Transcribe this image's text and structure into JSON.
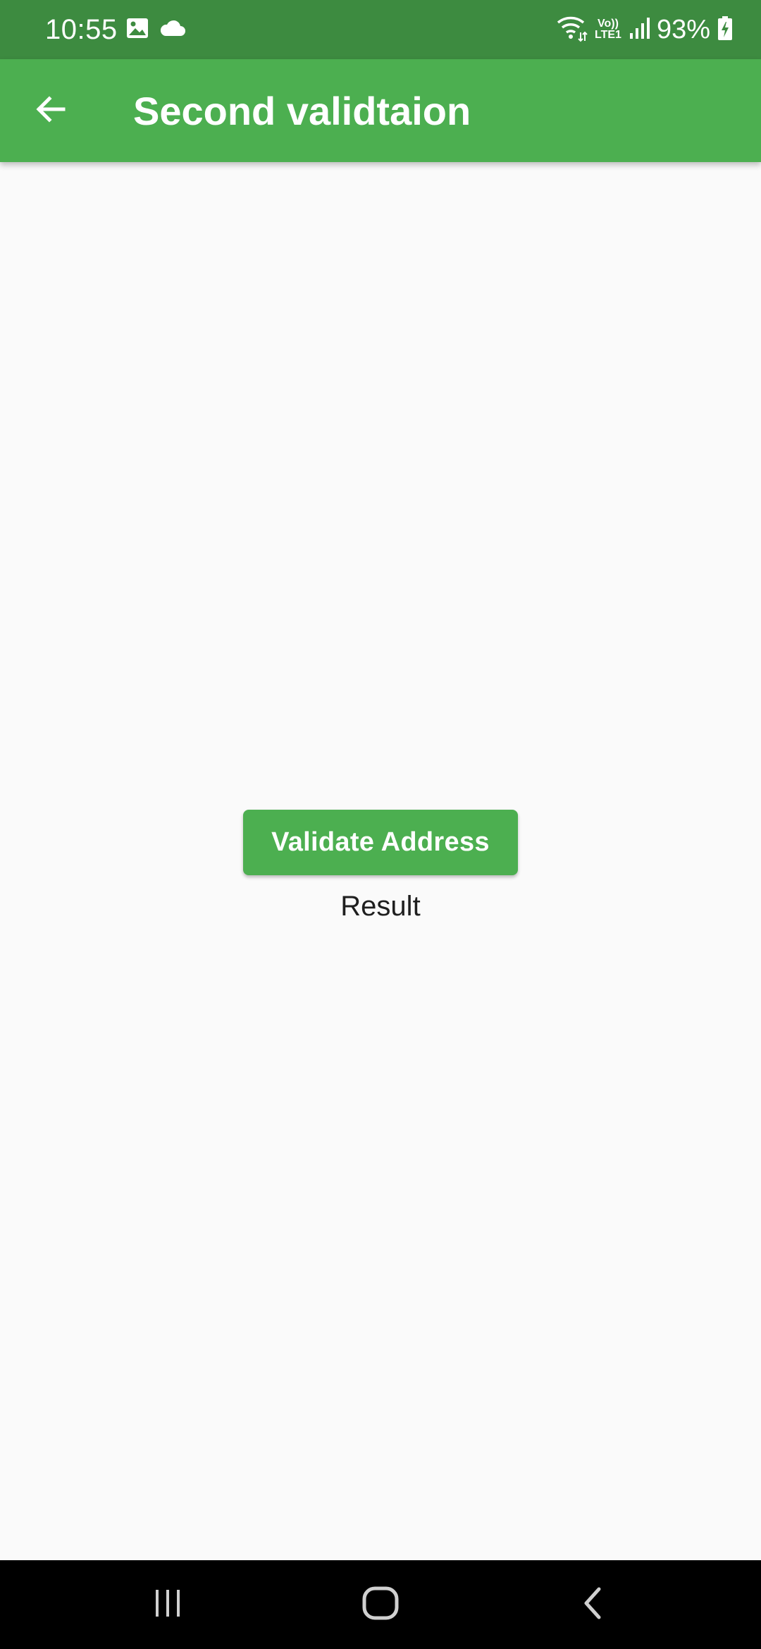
{
  "status_bar": {
    "time": "10:55",
    "battery_percent": "93%",
    "icons": [
      "image-icon",
      "cloud-icon",
      "wifi-icon",
      "volte-icon",
      "signal-icon",
      "battery-charging-icon"
    ],
    "volte_line1": "Vo))",
    "volte_line2": "LTE1"
  },
  "app_bar": {
    "title": "Second validtaion",
    "back_icon": "arrow-back-icon",
    "background_color": "#4caf50"
  },
  "main": {
    "validate_button_label": "Validate Address",
    "result_label": "Result"
  },
  "nav_bar": {
    "icons": [
      "recents-icon",
      "home-icon",
      "back-icon"
    ]
  }
}
